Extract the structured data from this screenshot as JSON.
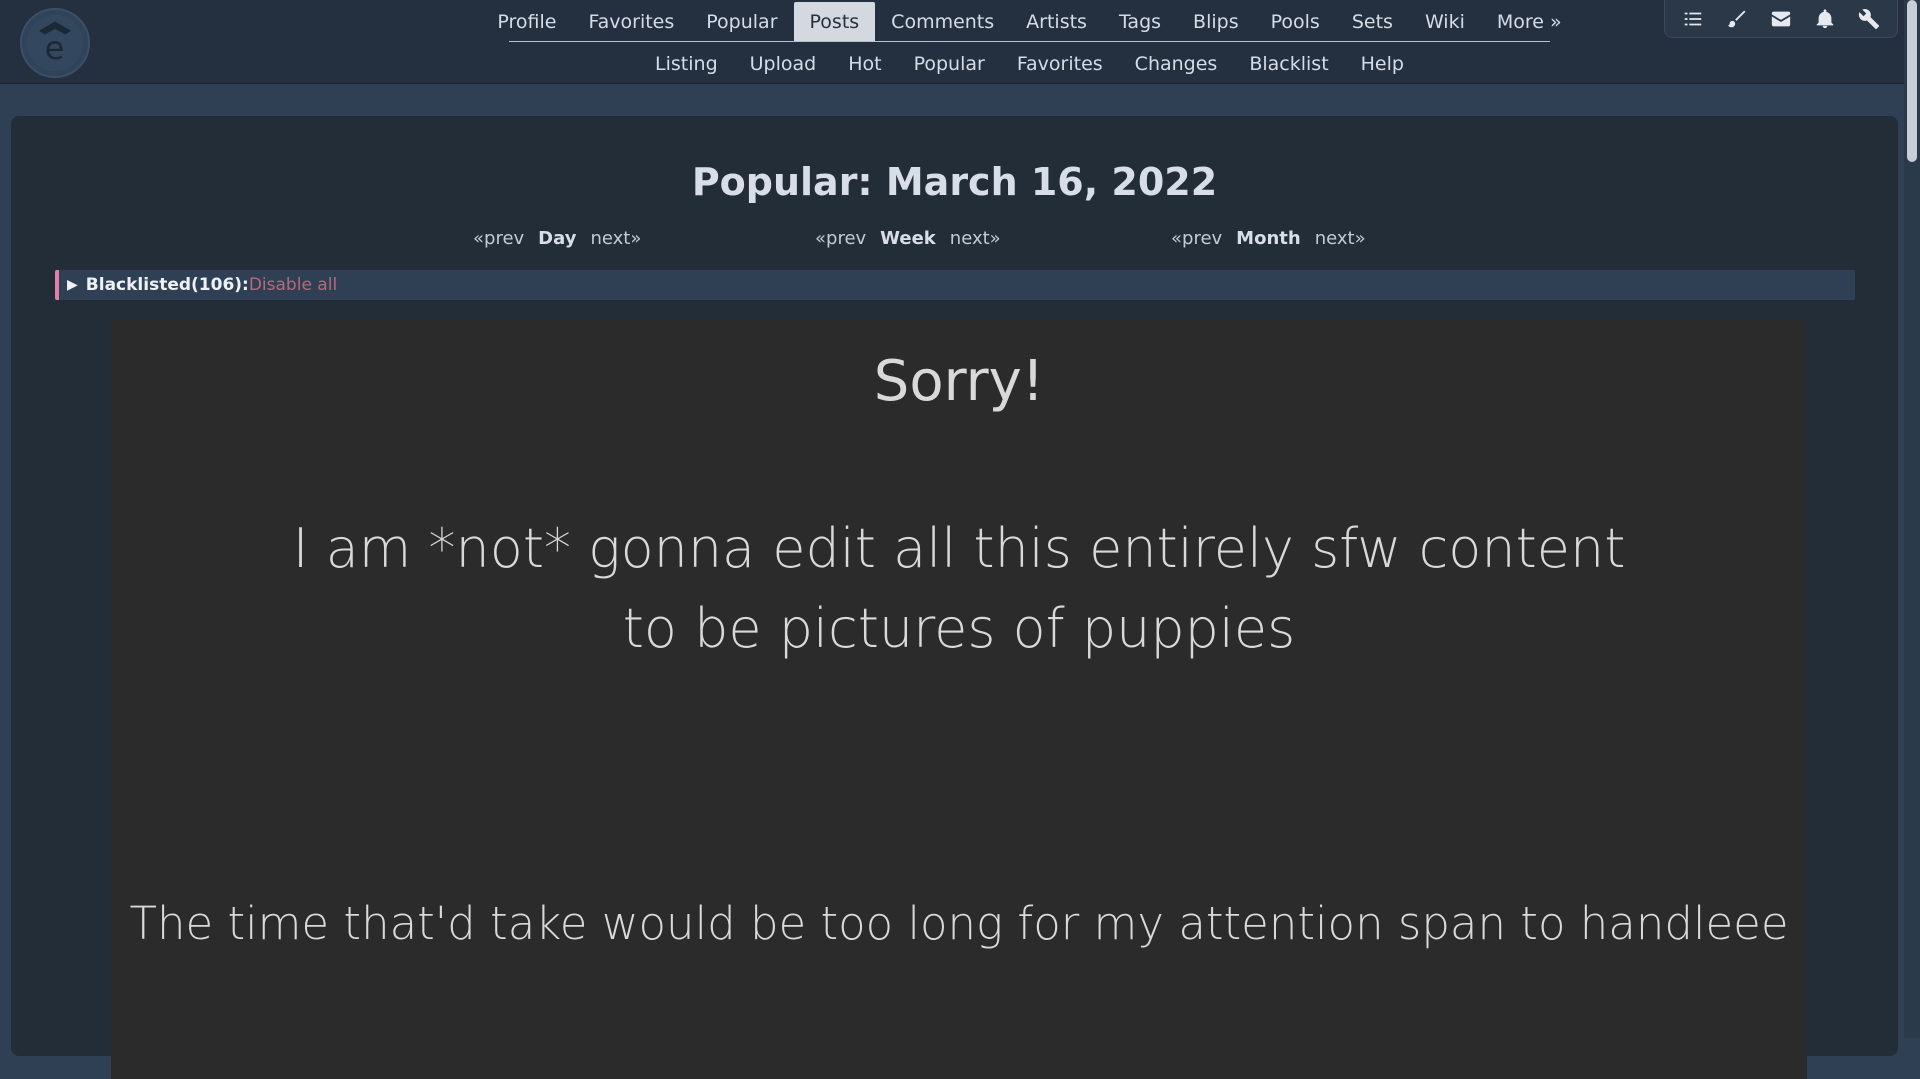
{
  "main_nav": [
    {
      "label": "Profile",
      "active": false
    },
    {
      "label": "Favorites",
      "active": false
    },
    {
      "label": "Popular",
      "active": false
    },
    {
      "label": "Posts",
      "active": true
    },
    {
      "label": "Comments",
      "active": false
    },
    {
      "label": "Artists",
      "active": false
    },
    {
      "label": "Tags",
      "active": false
    },
    {
      "label": "Blips",
      "active": false
    },
    {
      "label": "Pools",
      "active": false
    },
    {
      "label": "Sets",
      "active": false
    },
    {
      "label": "Wiki",
      "active": false
    },
    {
      "label": "More »",
      "active": false
    }
  ],
  "sub_nav": [
    {
      "label": "Listing"
    },
    {
      "label": "Upload"
    },
    {
      "label": "Hot"
    },
    {
      "label": "Popular"
    },
    {
      "label": "Favorites"
    },
    {
      "label": "Changes"
    },
    {
      "label": "Blacklist"
    },
    {
      "label": "Help"
    }
  ],
  "toolbox": [
    {
      "icon": "checklist-icon"
    },
    {
      "icon": "brush-icon"
    },
    {
      "icon": "envelope-icon"
    },
    {
      "icon": "bell-icon"
    },
    {
      "icon": "wrench-icon"
    }
  ],
  "page": {
    "title": "Popular: March 16, 2022"
  },
  "period_nav": {
    "day": {
      "prev": "«prev",
      "label": "Day",
      "next": "next»"
    },
    "week": {
      "prev": "«prev",
      "label": "Week",
      "next": "next»"
    },
    "month": {
      "prev": "«prev",
      "label": "Month",
      "next": "next»"
    }
  },
  "blacklist": {
    "arrow": "▶",
    "label": "Blacklisted(106):",
    "disable": "Disable all"
  },
  "post_image": {
    "heading": "Sorry!",
    "line1": "I am *not* gonna edit all this entirely sfw content",
    "line2": "to be pictures of puppies",
    "footer": "The time that'd take would be too long for my attention span to handleee"
  },
  "colors": {
    "background": "#2f4054",
    "header": "#243040",
    "panel": "#222d38",
    "accent": "#e07faa",
    "disable_link": "#b56a7a"
  }
}
